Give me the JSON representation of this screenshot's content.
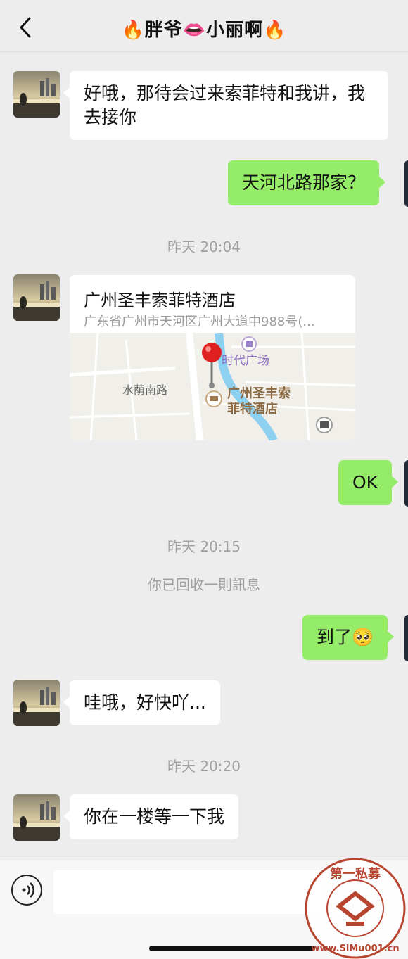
{
  "header": {
    "title": "🔥胖爷👄小丽啊🔥"
  },
  "messages": {
    "m1": "好哦，那待会过来索菲特和我讲，我去接你",
    "m2": "天河北路那家？",
    "t1": "昨天 20:04",
    "location": {
      "name": "广州圣丰索菲特酒店",
      "address": "广东省广州市天河区广州大道中988号(..."
    },
    "map": {
      "label_times_square": "时代广场",
      "label_road": "水荫南路",
      "label_hotel_line1": "广州圣丰索",
      "label_hotel_line2": "菲特酒店"
    },
    "m3": "OK",
    "t2": "昨天 20:15",
    "sys1": "你已回收一則訊息",
    "m4": "到了🥺",
    "m5": "哇哦，好快吖...",
    "t3": "昨天 20:20",
    "m6": "你在一楼等一下我"
  },
  "watermark": {
    "text_top": "第一私募",
    "text_bottom": "www.SiMu001.cn"
  },
  "colors": {
    "background": "#ededed",
    "bubble_out": "#95ec69",
    "bubble_in": "#ffffff",
    "watermark": "#b8452f"
  }
}
